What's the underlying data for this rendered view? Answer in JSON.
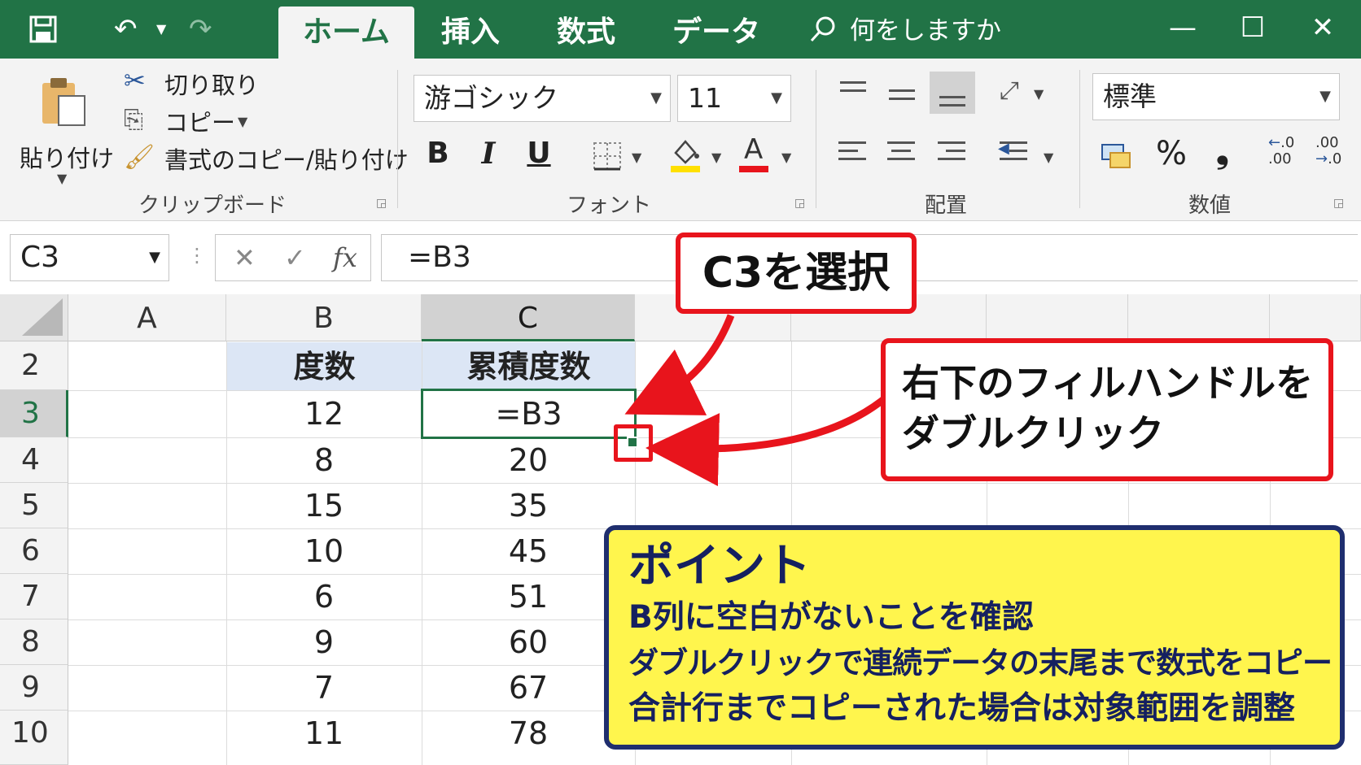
{
  "titlebar": {
    "tabs": [
      "ホーム",
      "挿入",
      "数式",
      "データ"
    ],
    "tell_me": "何をしますか"
  },
  "ribbon": {
    "clipboard": {
      "paste": "貼り付け",
      "cut": "切り取り",
      "copy": "コピー",
      "format_painter": "書式のコピー/貼り付け",
      "label": "クリップボード"
    },
    "font": {
      "family": "游ゴシック",
      "size": "11",
      "bold": "B",
      "italic": "I",
      "underline": "U",
      "font_color_glyph": "A",
      "label": "フォント"
    },
    "alignment": {
      "label": "配置"
    },
    "number": {
      "format": "標準",
      "percent": "%",
      "comma": "❟",
      "increase_decimal": "+.0\n.00",
      "decrease_decimal": ".00\n→.0",
      "label": "数値"
    }
  },
  "formula_bar": {
    "name_box": "C3",
    "cancel": "✕",
    "enter": "✓",
    "fx": "fx",
    "formula": "=B3"
  },
  "sheet": {
    "columns": [
      "A",
      "B",
      "C"
    ],
    "rows": [
      "2",
      "3",
      "4",
      "5",
      "6",
      "7",
      "8",
      "9",
      "10"
    ],
    "header_row": {
      "B": "度数",
      "C": "累積度数"
    },
    "data": [
      {
        "row": "3",
        "B": "12",
        "C": "=B3"
      },
      {
        "row": "4",
        "B": "8",
        "C": "20"
      },
      {
        "row": "5",
        "B": "15",
        "C": "35"
      },
      {
        "row": "6",
        "B": "10",
        "C": "45"
      },
      {
        "row": "7",
        "B": "6",
        "C": "51"
      },
      {
        "row": "8",
        "B": "9",
        "C": "60"
      },
      {
        "row": "9",
        "B": "7",
        "C": "67"
      },
      {
        "row": "10",
        "B": "11",
        "C": "78"
      }
    ]
  },
  "callouts": {
    "select": "C3を選択",
    "fill_line1": "右下のフィルハンドルを",
    "fill_line2": "ダブルクリック"
  },
  "note": {
    "title": "ポイント",
    "lines": [
      "B列に空白がないことを確認",
      "ダブルクリックで連続データの末尾まで数式をコピー",
      "合計行までコピーされた場合は対象範囲を調整"
    ]
  },
  "colors": {
    "excel_green": "#217346",
    "callout_red": "#e8141c",
    "note_yellow": "#fff54d",
    "note_navy": "#1f2e6e",
    "header_fill": "#dce6f5"
  }
}
